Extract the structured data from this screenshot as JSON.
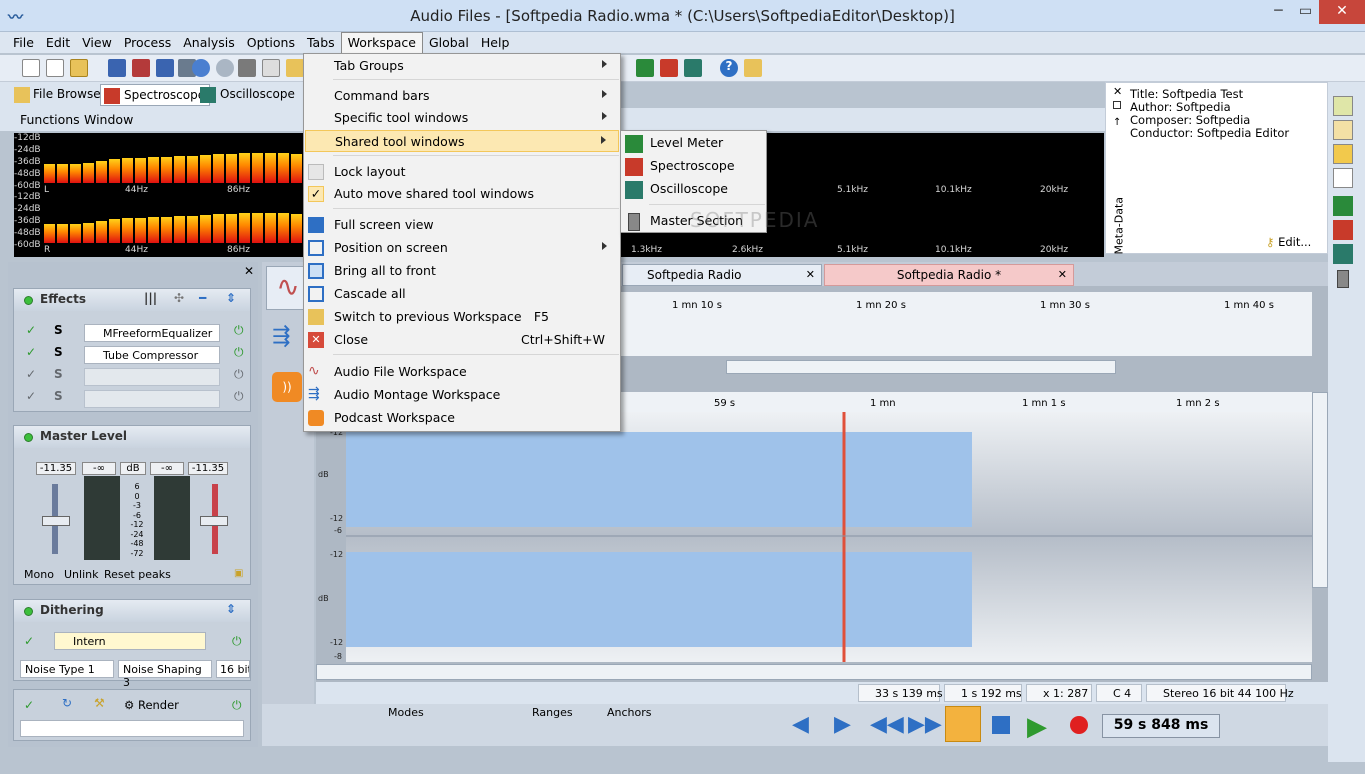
{
  "window": {
    "title": "Audio Files - [Softpedia Radio.wma * (C:\\Users\\SoftpediaEditor\\Desktop)]",
    "minimize": "─",
    "maximize": "▭",
    "close": "✕"
  },
  "menubar": [
    "File",
    "Edit",
    "View",
    "Process",
    "Analysis",
    "Options",
    "Tabs",
    "Workspace",
    "Global",
    "Help"
  ],
  "tool_tabs": [
    "File Browser",
    "Spectroscope",
    "Oscilloscope"
  ],
  "submenu_bar": [
    "Functions",
    "Window"
  ],
  "spectro": {
    "db_top": [
      "-12dB",
      "-24dB",
      "-36dB",
      "-48dB",
      "-60dB"
    ],
    "db_bottom": [
      "-12dB",
      "-24dB",
      "-36dB",
      "-48dB",
      "-60dB"
    ],
    "ch_top": "L",
    "ch_bottom": "R",
    "freqs_top": [
      "44Hz",
      "86Hz",
      "5.1kHz",
      "10.1kHz",
      "20kHz"
    ],
    "freqs_bottom": [
      "44Hz",
      "86Hz",
      "1.3kHz",
      "2.6kHz",
      "5.1kHz",
      "10.1kHz",
      "20kHz"
    ]
  },
  "metadata": {
    "title": "Title: Softpedia Test",
    "author": "Author: Softpedia",
    "composer": "Composer: Softpedia",
    "conductor": "Conductor: Softpedia Editor",
    "edit": "Edit...",
    "side_label": "Meta-Data"
  },
  "effects": {
    "header": "Effects",
    "items": [
      "MFreeformEqualizer",
      "Tube Compressor",
      "",
      ""
    ],
    "s_label": "S"
  },
  "master": {
    "header": "Master Level",
    "values": [
      "-11.35",
      "-∞",
      "dB",
      "-∞",
      "-11.35"
    ],
    "scale": [
      "6",
      "0",
      "-3",
      "-6",
      "-12",
      "-24",
      "-48",
      "-72"
    ],
    "buttons": [
      "Mono",
      "Unlink",
      "Reset peaks"
    ]
  },
  "dithering": {
    "header": "Dithering",
    "item": "Intern",
    "options": [
      "Noise Type 1",
      "Noise Shaping 3",
      "16 bit"
    ]
  },
  "render": {
    "label": "Render"
  },
  "editor_tabs": [
    "Softpedia Radio",
    "Softpedia Radio *"
  ],
  "overview_ruler": [
    "1 mn 10 s",
    "1 mn 20 s",
    "1 mn 30 s",
    "1 mn 40 s"
  ],
  "main_ruler": [
    "59 s",
    "1 mn",
    "1 mn 1 s",
    "1 mn 2 s"
  ],
  "wave_labels": [
    "-12",
    "dB",
    "-12",
    "-6",
    "-12",
    "dB",
    "-12",
    "-8"
  ],
  "status": {
    "cursor": "33 s 139 ms",
    "selection": "1 s 192 ms",
    "zoom": "x 1: 287",
    "note": "C 4",
    "format": "Stereo 16 bit 44 100 Hz"
  },
  "transport": {
    "modes": "Modes",
    "ranges": "Ranges",
    "anchors": "Anchors",
    "time": "59 s 848 ms"
  },
  "workspace_menu": [
    {
      "label": "Tab Groups",
      "arrow": true
    },
    {
      "label": "Command bars",
      "arrow": true
    },
    {
      "label": "Specific tool windows",
      "arrow": true
    },
    {
      "label": "Shared tool windows",
      "arrow": true
    },
    {
      "label": "Lock layout"
    },
    {
      "label": "Auto move shared tool windows",
      "check": "✓"
    },
    {
      "label": "Full screen view"
    },
    {
      "label": "Position on screen",
      "arrow": true
    },
    {
      "label": "Bring all to front"
    },
    {
      "label": "Cascade all"
    },
    {
      "label": "Switch to previous Workspace",
      "shortcut": "F5"
    },
    {
      "label": "Close",
      "shortcut": "Ctrl+Shift+W"
    },
    {
      "label": "Audio File Workspace"
    },
    {
      "label": "Audio Montage Workspace"
    },
    {
      "label": "Podcast Workspace"
    }
  ],
  "shared_submenu": [
    "Level Meter",
    "Spectroscope",
    "Oscilloscope",
    "Master Section"
  ],
  "watermark": "SOFTPEDIA"
}
